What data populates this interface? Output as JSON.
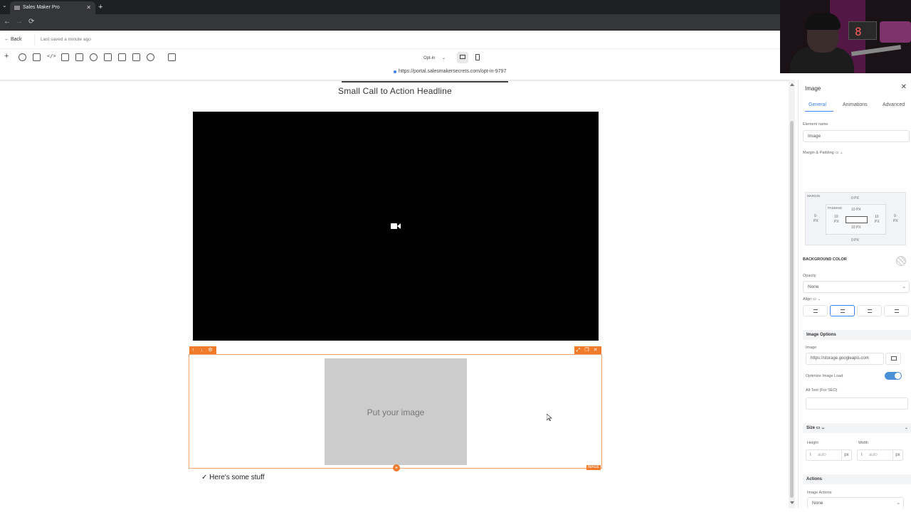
{
  "browser": {
    "tab_title": "Sales Maker Pro",
    "tab_close": "✕",
    "new_tab": "+",
    "nav": {
      "back": "←",
      "forward": "→",
      "reload": "⟳"
    }
  },
  "header": {
    "back_label": "Back",
    "saved_status": "Last saved a minute ago",
    "page_selector": "Opt-in"
  },
  "url_bar": {
    "url": "https://portal.salesmakersecrets.com/opt-in-9797"
  },
  "canvas": {
    "headline": "Small Call to Action Headline",
    "image_placeholder": "Put your image",
    "image_tag": "IMAGE",
    "add_symbol": "+",
    "list_item": "✓ Here's some stuff"
  },
  "panel": {
    "title": "Image",
    "close": "✕",
    "tabs": [
      "General",
      "Animations",
      "Advanced"
    ],
    "element_name_label": "Element name",
    "element_name_value": "Image",
    "margin_padding_label": "Margin & Padding",
    "margin_label": "MARGIN",
    "padding_label": "PADDING",
    "margin_top": "0 PX",
    "margin_bottom": "0 PX",
    "margin_left": "0",
    "margin_right": "0",
    "padding_top": "10 PX",
    "padding_bottom": "10 PX",
    "padding_left": "10",
    "padding_right": "10",
    "px_unit": "PX",
    "bg_color_label": "BACKGROUND COLOR",
    "opacity_label": "Opacity",
    "opacity_value": "None",
    "align_label": "Align",
    "image_options_label": "Image Options",
    "image_label": "Image",
    "image_url": "https://storage.googleapis.com",
    "optimize_label": "Optimize Image Load",
    "optimize_on": true,
    "alt_text_label": "Alt Text (For SEO)",
    "alt_text_value": "",
    "size_label": "Size",
    "height_label": "Height",
    "width_label": "Width",
    "height_placeholder": "auto",
    "width_placeholder": "auto",
    "unit": "px",
    "actions_label": "Actions",
    "image_actions_label": "Image Actions",
    "image_actions_value": "None"
  },
  "colors": {
    "accent": "#3b82f6",
    "selection": "#f07b2a",
    "video_bg": "#000000",
    "placeholder_bg": "#cccccc"
  },
  "webcam": {
    "clock_digit": "8"
  }
}
